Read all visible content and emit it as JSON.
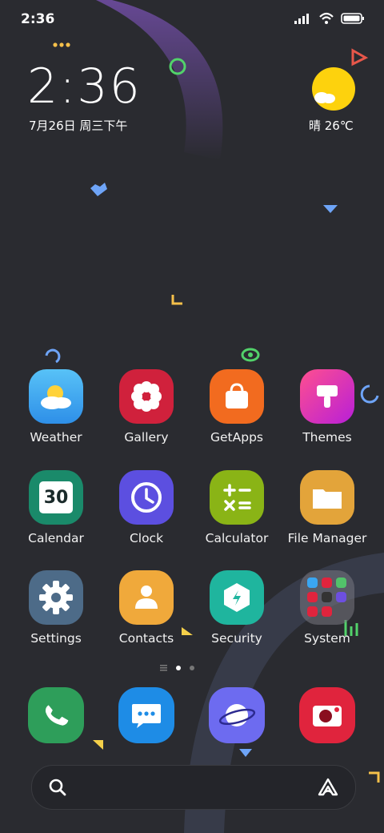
{
  "status_bar": {
    "time": "2:36"
  },
  "clock_widget": {
    "time": "2:36",
    "date": "7月26日 周三下午"
  },
  "weather_widget": {
    "condition_temp": "晴 26℃"
  },
  "apps": [
    {
      "label": "Weather"
    },
    {
      "label": "Gallery"
    },
    {
      "label": "GetApps"
    },
    {
      "label": "Themes"
    },
    {
      "label": "Calendar",
      "day": "30"
    },
    {
      "label": "Clock"
    },
    {
      "label": "Calculator"
    },
    {
      "label": "File Manager"
    },
    {
      "label": "Settings"
    },
    {
      "label": "Contacts"
    },
    {
      "label": "Security"
    },
    {
      "label": "System"
    }
  ],
  "dock": [
    "phone-icon",
    "messaging-icon",
    "browser-icon",
    "camera-icon"
  ],
  "page_indicator": {
    "pages": 2,
    "current": 1
  },
  "colors": {
    "background": "#2a2b30",
    "weather": "#3aa6f2",
    "gallery": "#d0213c",
    "getapps": "#f26b1f",
    "themes": "#e83fa0",
    "calendar": "#1a8a6a",
    "clock": "#5c4fe0",
    "calculator": "#8ab416",
    "file_manager": "#e3a43a",
    "settings": "#4d6b88",
    "contacts": "#f0a93b",
    "security": "#1fb59e",
    "phone": "#2e9e5a",
    "messaging": "#1e8ce6",
    "browser": "#6d6bf0",
    "camera": "#e0243d"
  }
}
